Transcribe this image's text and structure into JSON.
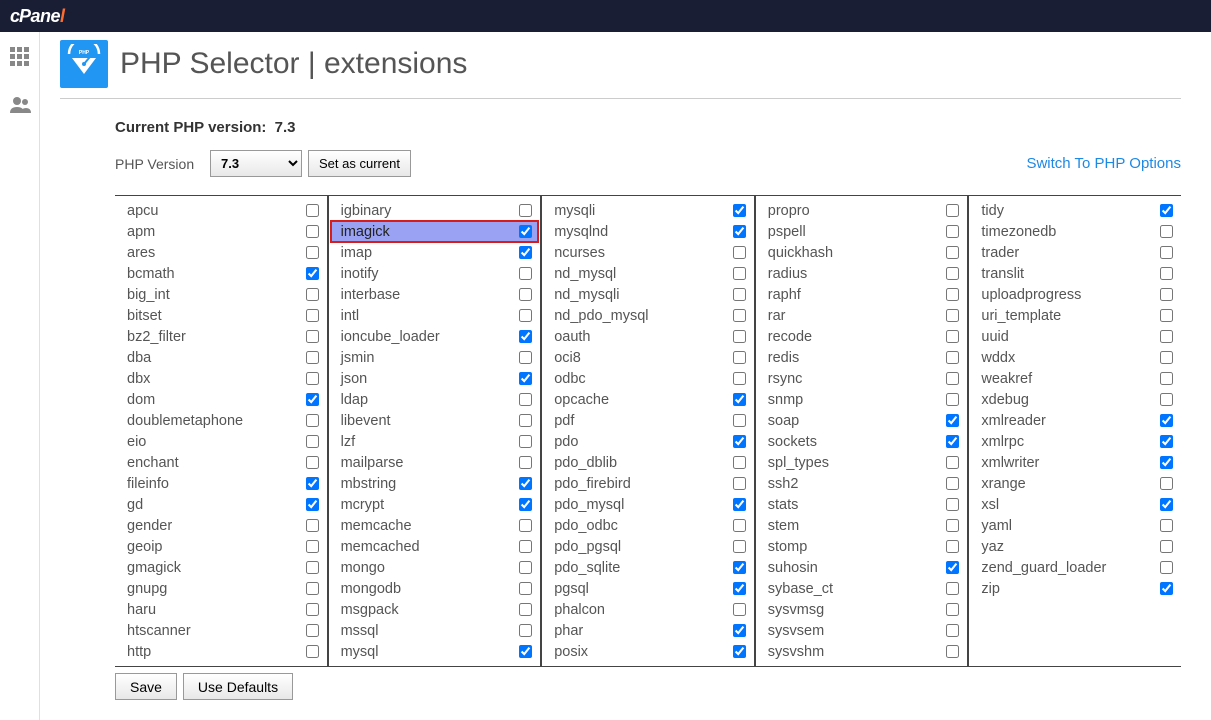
{
  "brand": "cPanel",
  "page_title": "PHP Selector | extensions",
  "current_version_label": "Current PHP version:",
  "current_version": "7.3",
  "php_version_label": "PHP Version",
  "php_version_selected": "7.3",
  "set_as_current_label": "Set as current",
  "switch_link_label": "Switch To PHP Options",
  "save_label": "Save",
  "use_defaults_label": "Use Defaults",
  "highlighted_extension": "imagick",
  "extensions": {
    "col1": [
      {
        "name": "apcu",
        "checked": false
      },
      {
        "name": "apm",
        "checked": false
      },
      {
        "name": "ares",
        "checked": false
      },
      {
        "name": "bcmath",
        "checked": true
      },
      {
        "name": "big_int",
        "checked": false
      },
      {
        "name": "bitset",
        "checked": false
      },
      {
        "name": "bz2_filter",
        "checked": false
      },
      {
        "name": "dba",
        "checked": false
      },
      {
        "name": "dbx",
        "checked": false
      },
      {
        "name": "dom",
        "checked": true
      },
      {
        "name": "doublemetaphone",
        "checked": false
      },
      {
        "name": "eio",
        "checked": false
      },
      {
        "name": "enchant",
        "checked": false
      },
      {
        "name": "fileinfo",
        "checked": true
      },
      {
        "name": "gd",
        "checked": true
      },
      {
        "name": "gender",
        "checked": false
      },
      {
        "name": "geoip",
        "checked": false
      },
      {
        "name": "gmagick",
        "checked": false
      },
      {
        "name": "gnupg",
        "checked": false
      },
      {
        "name": "haru",
        "checked": false
      },
      {
        "name": "htscanner",
        "checked": false
      },
      {
        "name": "http",
        "checked": false
      }
    ],
    "col2": [
      {
        "name": "igbinary",
        "checked": false
      },
      {
        "name": "imagick",
        "checked": true
      },
      {
        "name": "imap",
        "checked": true
      },
      {
        "name": "inotify",
        "checked": false
      },
      {
        "name": "interbase",
        "checked": false
      },
      {
        "name": "intl",
        "checked": false
      },
      {
        "name": "ioncube_loader",
        "checked": true
      },
      {
        "name": "jsmin",
        "checked": false
      },
      {
        "name": "json",
        "checked": true
      },
      {
        "name": "ldap",
        "checked": false
      },
      {
        "name": "libevent",
        "checked": false
      },
      {
        "name": "lzf",
        "checked": false
      },
      {
        "name": "mailparse",
        "checked": false
      },
      {
        "name": "mbstring",
        "checked": true
      },
      {
        "name": "mcrypt",
        "checked": true
      },
      {
        "name": "memcache",
        "checked": false
      },
      {
        "name": "memcached",
        "checked": false
      },
      {
        "name": "mongo",
        "checked": false
      },
      {
        "name": "mongodb",
        "checked": false
      },
      {
        "name": "msgpack",
        "checked": false
      },
      {
        "name": "mssql",
        "checked": false
      },
      {
        "name": "mysql",
        "checked": true
      }
    ],
    "col3": [
      {
        "name": "mysqli",
        "checked": true
      },
      {
        "name": "mysqlnd",
        "checked": true
      },
      {
        "name": "ncurses",
        "checked": false
      },
      {
        "name": "nd_mysql",
        "checked": false
      },
      {
        "name": "nd_mysqli",
        "checked": false
      },
      {
        "name": "nd_pdo_mysql",
        "checked": false
      },
      {
        "name": "oauth",
        "checked": false
      },
      {
        "name": "oci8",
        "checked": false
      },
      {
        "name": "odbc",
        "checked": false
      },
      {
        "name": "opcache",
        "checked": true
      },
      {
        "name": "pdf",
        "checked": false
      },
      {
        "name": "pdo",
        "checked": true
      },
      {
        "name": "pdo_dblib",
        "checked": false
      },
      {
        "name": "pdo_firebird",
        "checked": false
      },
      {
        "name": "pdo_mysql",
        "checked": true
      },
      {
        "name": "pdo_odbc",
        "checked": false
      },
      {
        "name": "pdo_pgsql",
        "checked": false
      },
      {
        "name": "pdo_sqlite",
        "checked": true
      },
      {
        "name": "pgsql",
        "checked": true
      },
      {
        "name": "phalcon",
        "checked": false
      },
      {
        "name": "phar",
        "checked": true
      },
      {
        "name": "posix",
        "checked": true
      }
    ],
    "col4": [
      {
        "name": "propro",
        "checked": false
      },
      {
        "name": "pspell",
        "checked": false
      },
      {
        "name": "quickhash",
        "checked": false
      },
      {
        "name": "radius",
        "checked": false
      },
      {
        "name": "raphf",
        "checked": false
      },
      {
        "name": "rar",
        "checked": false
      },
      {
        "name": "recode",
        "checked": false
      },
      {
        "name": "redis",
        "checked": false
      },
      {
        "name": "rsync",
        "checked": false
      },
      {
        "name": "snmp",
        "checked": false
      },
      {
        "name": "soap",
        "checked": true
      },
      {
        "name": "sockets",
        "checked": true
      },
      {
        "name": "spl_types",
        "checked": false
      },
      {
        "name": "ssh2",
        "checked": false
      },
      {
        "name": "stats",
        "checked": false
      },
      {
        "name": "stem",
        "checked": false
      },
      {
        "name": "stomp",
        "checked": false
      },
      {
        "name": "suhosin",
        "checked": true
      },
      {
        "name": "sybase_ct",
        "checked": false
      },
      {
        "name": "sysvmsg",
        "checked": false
      },
      {
        "name": "sysvsem",
        "checked": false
      },
      {
        "name": "sysvshm",
        "checked": false
      }
    ],
    "col5": [
      {
        "name": "tidy",
        "checked": true
      },
      {
        "name": "timezonedb",
        "checked": false
      },
      {
        "name": "trader",
        "checked": false
      },
      {
        "name": "translit",
        "checked": false
      },
      {
        "name": "uploadprogress",
        "checked": false
      },
      {
        "name": "uri_template",
        "checked": false
      },
      {
        "name": "uuid",
        "checked": false
      },
      {
        "name": "wddx",
        "checked": false
      },
      {
        "name": "weakref",
        "checked": false
      },
      {
        "name": "xdebug",
        "checked": false
      },
      {
        "name": "xmlreader",
        "checked": true
      },
      {
        "name": "xmlrpc",
        "checked": true
      },
      {
        "name": "xmlwriter",
        "checked": true
      },
      {
        "name": "xrange",
        "checked": false
      },
      {
        "name": "xsl",
        "checked": true
      },
      {
        "name": "yaml",
        "checked": false
      },
      {
        "name": "yaz",
        "checked": false
      },
      {
        "name": "zend_guard_loader",
        "checked": false
      },
      {
        "name": "zip",
        "checked": true
      }
    ]
  }
}
